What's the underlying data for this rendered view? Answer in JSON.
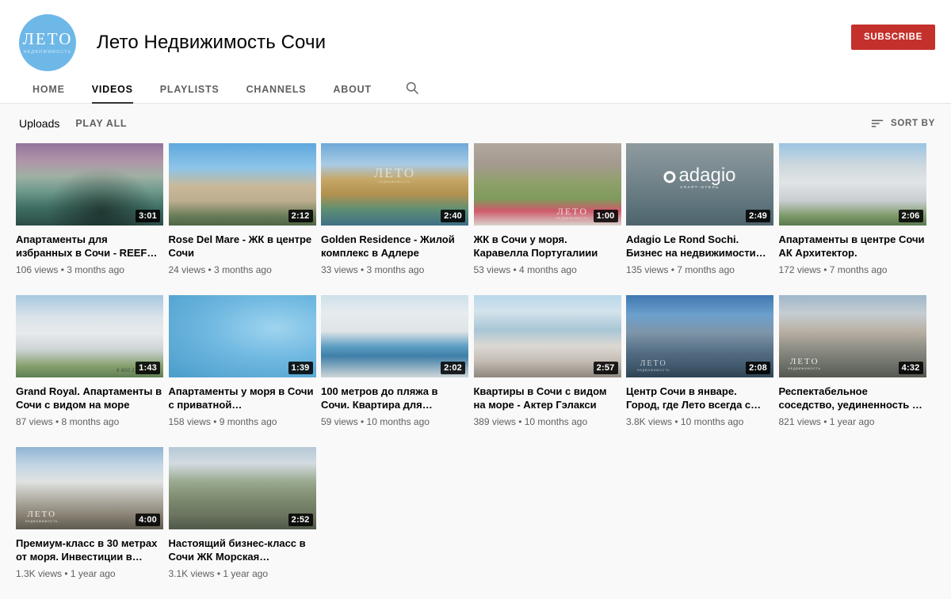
{
  "brand": {
    "accent_red": "#c4302b",
    "avatar_bg": "#6eb8e8",
    "avatar_main": "ЛЕТО",
    "avatar_sub": "НЕДВИЖИМОСТЬ"
  },
  "header": {
    "channel_title": "Лето Недвижимость Сочи",
    "subscribe_label": "SUBSCRIBE"
  },
  "tabs": [
    {
      "label": "HOME",
      "active": false
    },
    {
      "label": "VIDEOS",
      "active": true
    },
    {
      "label": "PLAYLISTS",
      "active": false
    },
    {
      "label": "CHANNELS",
      "active": false
    },
    {
      "label": "ABOUT",
      "active": false
    }
  ],
  "search": {
    "icon": "search-icon"
  },
  "subheader": {
    "section_label": "Uploads",
    "play_all_label": "PLAY ALL",
    "sort_by_label": "SORT BY",
    "sort_icon": "sort-lines-icon"
  },
  "videos": [
    {
      "title": "Апартаменты для избранных в Сочи - REEF…",
      "duration": "3:01",
      "views": "106 views",
      "age": "3 months ago",
      "bg": "bg-1",
      "watermark": null
    },
    {
      "title": "Rose Del Mare - ЖК в центре Сочи",
      "duration": "2:12",
      "views": "24 views",
      "age": "3 months ago",
      "bg": "bg-2",
      "watermark": null
    },
    {
      "title": "Golden Residence - Жилой комплекс в Адлере",
      "duration": "2:40",
      "views": "33 views",
      "age": "3 months ago",
      "bg": "bg-3",
      "watermark": "ЛЕТО"
    },
    {
      "title": "ЖК в Сочи у моря. Каравелла Португалиии",
      "duration": "1:00",
      "views": "53 views",
      "age": "4 months ago",
      "bg": "bg-4",
      "watermark": "ЛЕТО"
    },
    {
      "title": "Adagio Le Rond Sochi. Бизнес на недвижимости…",
      "duration": "2:49",
      "views": "135 views",
      "age": "7 months ago",
      "bg": "bg-5",
      "watermark": "adagio"
    },
    {
      "title": "Апартаменты в центре Сочи АК Архитектор.",
      "duration": "2:06",
      "views": "172 views",
      "age": "7 months ago",
      "bg": "bg-6",
      "watermark": null
    },
    {
      "title": "Grand Royal. Апартаменты в Сочи с видом на море",
      "duration": "1:43",
      "views": "87 views",
      "age": "8 months ago",
      "bg": "bg-7",
      "watermark": "8 800 2"
    },
    {
      "title": "Апартаменты у моря в Сочи с приватной…",
      "duration": "1:39",
      "views": "158 views",
      "age": "9 months ago",
      "bg": "bg-8",
      "watermark": null
    },
    {
      "title": "100 метров до пляжа в Сочи. Квартира для…",
      "duration": "2:02",
      "views": "59 views",
      "age": "10 months ago",
      "bg": "bg-9",
      "watermark": null
    },
    {
      "title": "Квартиры в Сочи с видом на море - Актер Гэлакси",
      "duration": "2:57",
      "views": "389 views",
      "age": "10 months ago",
      "bg": "bg-10",
      "watermark": null
    },
    {
      "title": "Центр Сочи в январе. Город, где Лето всегда с…",
      "duration": "2:08",
      "views": "3.8K views",
      "age": "10 months ago",
      "bg": "bg-11",
      "watermark": "ЛЕТО"
    },
    {
      "title": "Респектабельное соседство, уединенность …",
      "duration": "4:32",
      "views": "821 views",
      "age": "1 year ago",
      "bg": "bg-12",
      "watermark": "ЛЕТО"
    },
    {
      "title": "Премиум-класс в 30 метрах от моря. Инвестиции в…",
      "duration": "4:00",
      "views": "1.3K views",
      "age": "1 year ago",
      "bg": "bg-13",
      "watermark": "ЛЕТО"
    },
    {
      "title": "Настоящий бизнес-класс в Сочи ЖК Морская…",
      "duration": "2:52",
      "views": "3.1K views",
      "age": "1 year ago",
      "bg": "bg-14",
      "watermark": null
    }
  ]
}
